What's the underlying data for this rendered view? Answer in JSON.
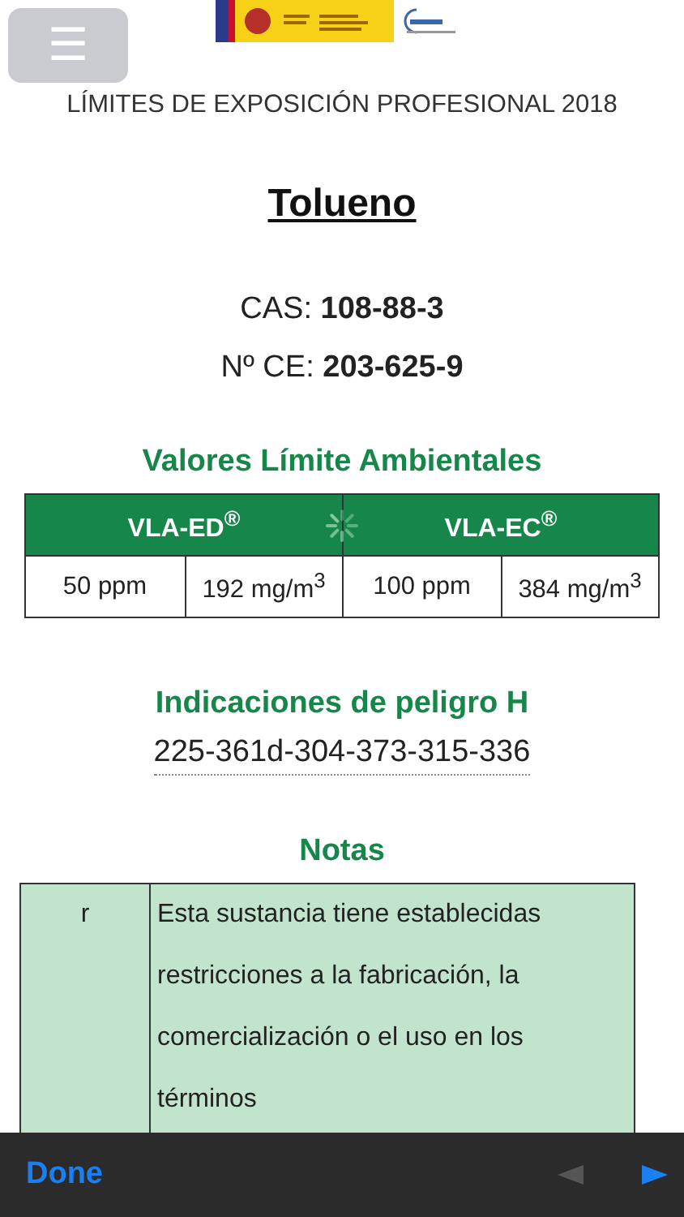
{
  "header": {
    "menu_button": "☰",
    "subtitle": "LÍMITES DE EXPOSICIÓN PROFESIONAL 2018"
  },
  "substance": {
    "name": "Tolueno",
    "identifiers": [
      {
        "label": "CAS:",
        "value": "108-88-3"
      },
      {
        "label": "Nº CE:",
        "value": "203-625-9"
      }
    ]
  },
  "limit_values": {
    "title": "Valores Límite Ambientales",
    "loading": true,
    "columns": [
      "VLA-ED$^{®}$",
      "VLA-EC$^{®}$"
    ],
    "cells": [
      "50 ppm",
      "192 mg/m$^{3}$",
      "100 ppm",
      "384 mg/m$^{3}$"
    ]
  },
  "hazard": {
    "title": "Indicaciones de peligro H",
    "codes": "225-361d-304-373-315-336"
  },
  "notes": {
    "title": "Notas",
    "rows": [
      {
        "code": "r",
        "text": "Esta sustancia tiene establecidas restricciones a la fabricación, la comercialización o el uso en los términos"
      }
    ]
  },
  "toolbar": {
    "done": "Done",
    "arrows": [
      {
        "kind": "prev",
        "disabled": true
      },
      {
        "kind": "next",
        "disabled": false
      }
    ]
  }
}
